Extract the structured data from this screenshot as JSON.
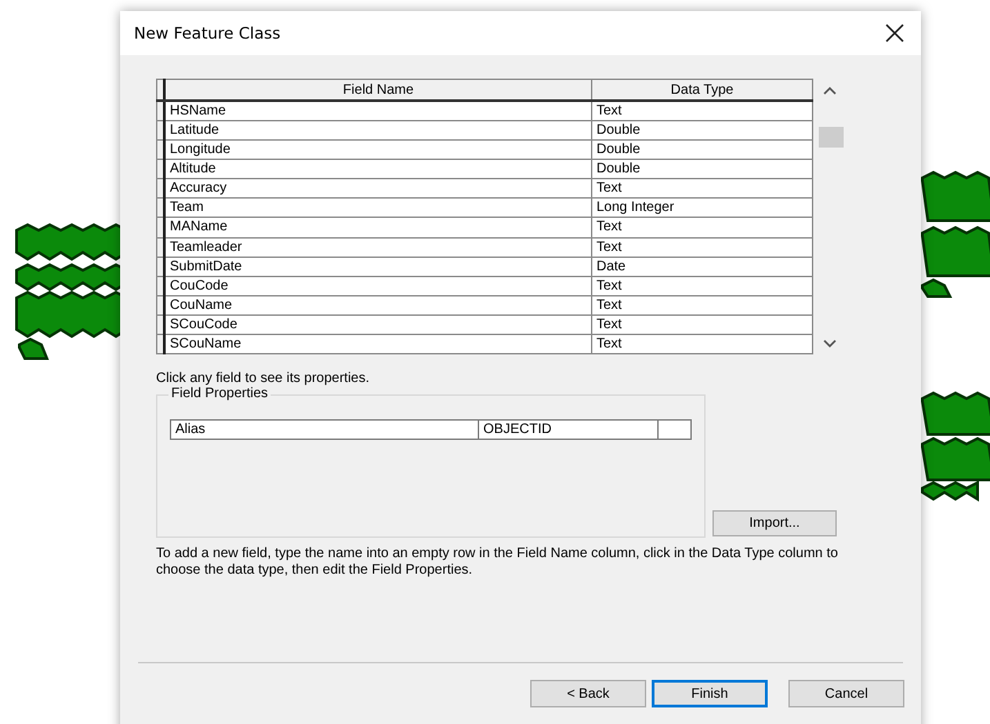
{
  "window": {
    "title": "New Feature Class"
  },
  "fields_table": {
    "columns": [
      "Field Name",
      "Data Type"
    ],
    "rows": [
      {
        "name": "HSName",
        "type": "Text"
      },
      {
        "name": "Latitude",
        "type": "Double"
      },
      {
        "name": "Longitude",
        "type": "Double"
      },
      {
        "name": "Altitude",
        "type": "Double"
      },
      {
        "name": "Accuracy",
        "type": "Text"
      },
      {
        "name": "Team",
        "type": "Long Integer"
      },
      {
        "name": "MAName",
        "type": "Text"
      },
      {
        "name": "Teamleader",
        "type": "Text"
      },
      {
        "name": "SubmitDate",
        "type": "Date"
      },
      {
        "name": "CouCode",
        "type": "Text"
      },
      {
        "name": "CouName",
        "type": "Text"
      },
      {
        "name": "SCouCode",
        "type": "Text"
      },
      {
        "name": "SCouName",
        "type": "Text"
      }
    ]
  },
  "hint": "Click any field to see its properties.",
  "field_properties": {
    "title": "Field Properties",
    "rows": [
      {
        "property": "Alias",
        "value": "OBJECTID"
      }
    ],
    "import_button": "Import..."
  },
  "instructions": "To add a new field, type the name into an empty row in the Field Name column, click in the Data Type column to choose the data type, then edit the Field Properties.",
  "buttons": [
    {
      "label": "< Back",
      "default": false
    },
    {
      "label": "Finish",
      "default": true
    },
    {
      "label": "Cancel",
      "default": false
    }
  ]
}
